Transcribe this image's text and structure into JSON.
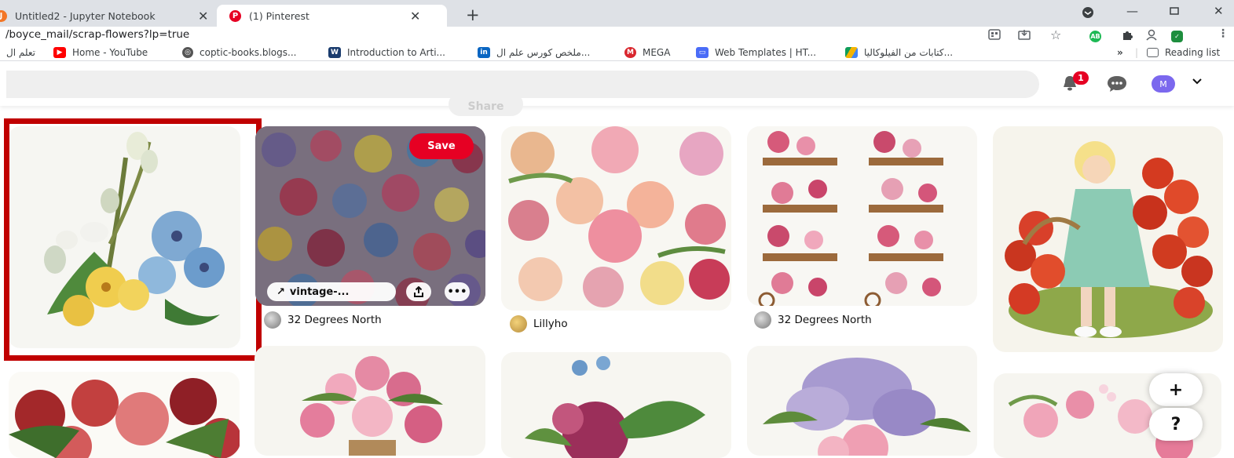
{
  "browser": {
    "tabs": [
      {
        "title": "Untitled2 - Jupyter Notebook",
        "close": "✕"
      },
      {
        "title": "(1) Pinterest",
        "close": "✕"
      }
    ],
    "new_tab": "+",
    "url": "/boyce_mail/scrap-flowers?lp=true",
    "bookmarks": [
      {
        "label": "تعلم ال"
      },
      {
        "label": "Home - YouTube"
      },
      {
        "label": "coptic-books.blogs..."
      },
      {
        "label": "Introduction to Arti..."
      },
      {
        "label": "ملخص كورس علم ال..."
      },
      {
        "label": "MEGA"
      },
      {
        "label": "Web Templates | HT..."
      },
      {
        "label": "كتابات من الفيلوكاليا..."
      }
    ],
    "more_bookmarks": "»",
    "reading_list": "Reading list"
  },
  "header": {
    "notification_count": "1",
    "avatar_letter": "M",
    "share_label": "Share"
  },
  "pins": {
    "save_label": "Save",
    "link_label": "vintage-...",
    "authors": [
      "32 Degrees North",
      "Lillyho",
      "32 Degrees North"
    ]
  },
  "fab": {
    "add": "+",
    "help": "?"
  },
  "colors": {
    "pinterest_red": "#e60023",
    "highlight": "#c00000",
    "search_bg": "#efefef"
  }
}
